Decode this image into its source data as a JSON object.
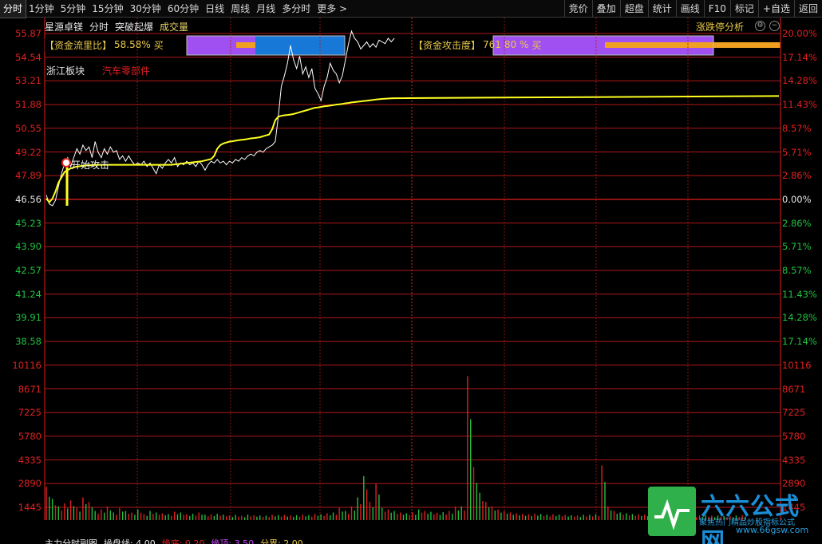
{
  "toolbar": {
    "periods": [
      "分时",
      "1分钟",
      "5分钟",
      "15分钟",
      "30分钟",
      "60分钟",
      "日线",
      "周线",
      "月线",
      "多分时",
      "更多 >"
    ],
    "active": "分时",
    "buttons": [
      "竞价",
      "叠加",
      "超盘",
      "统计",
      "画线",
      "F10",
      "标记",
      "+自选",
      "返回"
    ]
  },
  "header": {
    "stock_name": "星源卓镁",
    "period": "分时",
    "indicator": "突破起爆",
    "indicator2": "成交量",
    "analysis": "涨跌停分析"
  },
  "panels": {
    "flow_ratio": {
      "label": "【资金流里比】",
      "value": "58.58%",
      "suffix": "买"
    },
    "attack": {
      "label": "【资金攻击度】",
      "value": "761",
      "value2": "80 %",
      "suffix": "买"
    }
  },
  "sector": {
    "board": "浙江板块",
    "concept": "汽车零部件"
  },
  "annotation": "开始攻击",
  "y_left_price": [
    "55.87",
    "54.54",
    "53.21",
    "51.88",
    "50.55",
    "49.22",
    "47.89",
    "46.56",
    "45.23",
    "43.90",
    "42.57",
    "41.24",
    "39.91",
    "38.58"
  ],
  "y_right_pct": [
    "20.00%",
    "17.14%",
    "14.28%",
    "11.43%",
    "8.57%",
    "5.71%",
    "2.86%",
    "0.00%",
    "2.86%",
    "5.71%",
    "8.57%",
    "11.43%",
    "14.28%",
    "17.14%"
  ],
  "y_volume": [
    "10116",
    "8671",
    "7225",
    "5780",
    "4335",
    "2890",
    "1445"
  ],
  "bottom": {
    "title": "主力分时副图",
    "a": "操盘线: 4.00",
    "b": "绝底: 0.20",
    "c": "绝顶: 3.50",
    "d": "分界: 2.00"
  },
  "watermark": {
    "title": "六六公式网",
    "sub": "聚焦热门精品炒股指标公式",
    "url": "www.66gsw.com"
  },
  "colors": {
    "grid": "#b01818",
    "up": "#e02020",
    "down": "#20c040",
    "price_line": "#ffffff",
    "avg_line": "#ffff20",
    "purple": "#a050f0",
    "blue": "#1878d8",
    "orange": "#f0a020"
  },
  "chart_data": {
    "type": "line",
    "prev_close": 46.56,
    "ylim": [
      38.58,
      55.87
    ],
    "price": [
      46.8,
      46.3,
      46.2,
      46.5,
      47.3,
      48.0,
      48.6,
      48.9,
      48.4,
      48.9,
      49.4,
      49.1,
      49.6,
      49.3,
      49.5,
      48.9,
      49.8,
      49.2,
      48.9,
      49.4,
      49.1,
      49.5,
      49.2,
      49.3,
      48.8,
      49.0,
      48.7,
      49.0,
      48.7,
      48.5,
      48.6,
      48.5,
      48.7,
      48.4,
      48.6,
      48.3,
      48.0,
      48.5,
      48.3,
      48.6,
      48.8,
      48.6,
      48.9,
      48.4,
      48.6,
      48.5,
      48.7,
      48.5,
      48.6,
      48.4,
      48.7,
      48.5,
      48.2,
      48.5,
      48.7,
      48.6,
      48.8,
      48.6,
      48.7,
      48.5,
      48.7,
      48.6,
      48.8,
      48.7,
      48.9,
      48.8,
      49.0,
      49.1,
      49.0,
      49.2,
      49.3,
      49.2,
      49.4,
      49.5,
      49.6,
      49.8,
      51.2,
      52.9,
      53.5,
      54.2,
      55.2,
      54.4,
      53.9,
      54.6,
      53.6,
      54.0,
      53.4,
      53.9,
      52.8,
      52.5,
      52.1,
      52.9,
      53.4,
      54.2,
      53.8,
      53.6,
      53.1,
      53.5,
      54.4,
      55.3,
      56.0,
      55.6,
      55.4,
      55.0,
      55.2,
      55.4,
      55.1,
      55.3,
      55.1,
      55.5,
      55.4,
      55.3,
      55.6,
      55.4,
      55.6
    ],
    "avg": [
      46.6,
      46.4,
      46.6,
      47.0,
      47.5,
      47.8,
      48.1,
      48.2,
      48.3,
      48.35,
      48.4,
      48.42,
      48.44,
      48.46,
      48.47,
      48.48,
      48.49,
      48.5,
      48.5,
      48.5,
      48.5,
      48.5,
      48.5,
      48.5,
      48.5,
      48.5,
      48.5,
      48.5,
      48.5,
      48.5,
      48.5,
      48.5,
      48.5,
      48.5,
      48.5,
      48.5,
      48.5,
      48.5,
      48.5,
      48.5,
      48.5,
      48.5,
      48.52,
      48.54,
      48.56,
      48.58,
      48.6,
      48.62,
      48.64,
      48.66,
      48.68,
      48.7,
      48.74,
      48.78,
      48.82,
      49.0,
      49.4,
      49.6,
      49.7,
      49.75,
      49.8,
      49.82,
      49.85,
      49.88,
      49.9,
      49.92,
      49.95,
      49.98,
      50.0,
      50.02,
      50.05,
      50.1,
      50.15,
      50.2,
      50.5,
      51.0,
      51.2,
      51.25,
      51.28,
      51.3,
      51.32,
      51.35,
      51.4,
      51.45,
      51.5,
      51.55,
      51.6,
      51.65,
      51.7,
      51.72,
      51.75,
      51.78,
      51.8,
      51.82,
      51.85,
      51.88,
      51.9,
      51.92,
      51.95,
      51.97,
      52.0,
      52.02,
      52.04,
      52.06,
      52.08,
      52.1,
      52.12,
      52.14,
      52.16,
      52.18,
      52.2,
      52.21,
      52.22,
      52.23,
      52.24
    ],
    "volume": [
      2200,
      1400,
      900,
      1100,
      1300,
      800,
      1500,
      1200,
      600,
      700,
      900,
      500,
      800,
      600,
      500,
      700,
      400,
      600,
      500,
      450,
      400,
      550,
      500,
      380,
      420,
      500,
      350,
      380,
      420,
      360,
      300,
      340,
      280,
      360,
      320,
      300,
      290,
      350,
      330,
      340,
      300,
      320,
      350,
      330,
      400,
      380,
      450,
      500,
      800,
      600,
      900,
      1500,
      2900,
      1200,
      2400,
      800,
      700,
      600,
      500,
      450,
      500,
      700,
      600,
      550,
      480,
      520,
      600,
      900,
      900,
      9500,
      3500,
      1800,
      1200,
      900,
      700,
      600,
      500,
      450,
      400,
      380,
      420,
      400,
      350,
      380,
      360,
      340,
      320,
      300,
      350,
      340,
      380,
      3600,
      900,
      600,
      500,
      450,
      400,
      380,
      360,
      340,
      420,
      380,
      360,
      340,
      320,
      300,
      280,
      300,
      320,
      280,
      300,
      260,
      280,
      300,
      320
    ]
  }
}
